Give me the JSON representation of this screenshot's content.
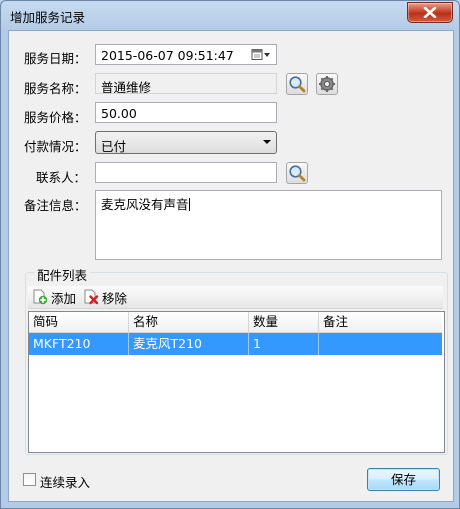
{
  "window": {
    "title": "增加服务记录"
  },
  "form": {
    "date_label": "服务日期：",
    "date_value": "2015-06-07 09:51:47",
    "name_label": "服务名称：",
    "name_value": "普通维修",
    "price_label": "服务价格：",
    "price_value": "50.00",
    "payment_label": "付款情况：",
    "payment_value": "已付",
    "contact_label": "联系人：",
    "contact_value": "",
    "notes_label": "备注信息：",
    "notes_value": "麦克风没有声音"
  },
  "parts": {
    "group_title": "配件列表",
    "add_label": "添加",
    "remove_label": "移除",
    "columns": [
      "简码",
      "名称",
      "数量",
      "备注"
    ],
    "rows": [
      {
        "code": "MKFT210",
        "name": "麦克风T210",
        "qty": "1",
        "note": ""
      }
    ]
  },
  "footer": {
    "continuous_label": "连续录入",
    "continuous_checked": false,
    "save_label": "保存"
  },
  "colors": {
    "selection": "#3399ff",
    "titlebar": "#b9d1ea",
    "close": "#c7432b"
  }
}
